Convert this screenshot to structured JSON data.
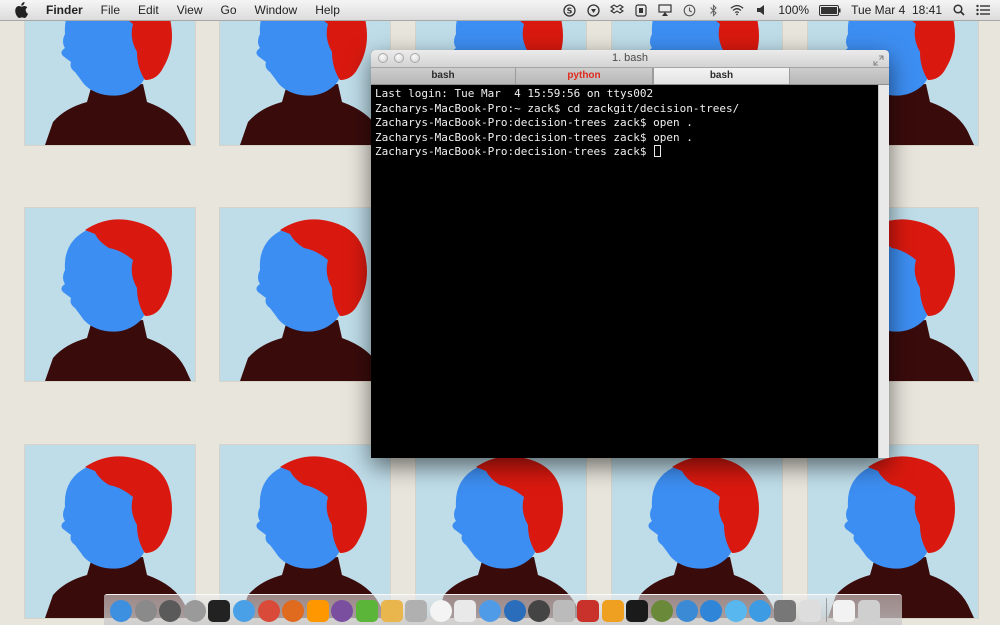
{
  "menubar": {
    "app_name": "Finder",
    "menus": [
      "File",
      "Edit",
      "View",
      "Go",
      "Window",
      "Help"
    ],
    "status_icons": [
      "skype-icon",
      "evernote-icon",
      "dropbox-icon",
      "growl-icon",
      "airplay-icon",
      "time-machine-icon",
      "bluetooth-icon",
      "wifi-icon",
      "volume-icon"
    ],
    "battery": "100%",
    "datetime": "Tue Mar 4  18:41",
    "right_icons": [
      "spotlight-icon",
      "notification-center-icon"
    ]
  },
  "terminal": {
    "title": "1. bash",
    "tabs": [
      {
        "label": "bash",
        "active": false,
        "busy": false
      },
      {
        "label": "python",
        "active": false,
        "busy": true
      },
      {
        "label": "bash",
        "active": true,
        "busy": false
      }
    ],
    "lines": [
      "Last login: Tue Mar  4 15:59:56 on ttys002",
      "Zacharys-MacBook-Pro:~ zack$ cd zackgit/decision-trees/",
      "Zacharys-MacBook-Pro:decision-trees zack$ open .",
      "Zacharys-MacBook-Pro:decision-trees zack$ open .",
      "Zacharys-MacBook-Pro:decision-trees zack$ "
    ]
  },
  "dock": {
    "apps": [
      {
        "name": "finder-icon",
        "color": "#3d8fe0"
      },
      {
        "name": "launchpad-icon",
        "color": "#8a8a8a"
      },
      {
        "name": "activity-monitor-icon",
        "color": "#5a5a5a"
      },
      {
        "name": "calculator-icon",
        "color": "#9a9a9a"
      },
      {
        "name": "terminal-icon",
        "color": "#222222"
      },
      {
        "name": "safari-icon",
        "color": "#4aa0e6"
      },
      {
        "name": "chrome-icon",
        "color": "#d94a38"
      },
      {
        "name": "firefox-icon",
        "color": "#e06a1e"
      },
      {
        "name": "sublime-text-icon",
        "color": "#ff9800"
      },
      {
        "name": "emacs-icon",
        "color": "#7b4fa0"
      },
      {
        "name": "evernote-icon",
        "color": "#5bb538"
      },
      {
        "name": "sketch-icon",
        "color": "#e8b64c"
      },
      {
        "name": "preview-icon",
        "color": "#b0b0b0"
      },
      {
        "name": "calendar-icon",
        "color": "#f4f4f4"
      },
      {
        "name": "reminders-icon",
        "color": "#e9e9e9"
      },
      {
        "name": "messages-icon",
        "color": "#4f9be8"
      },
      {
        "name": "r-icon",
        "color": "#2a6ebb"
      },
      {
        "name": "photo-booth-icon",
        "color": "#444444"
      },
      {
        "name": "photo-icon",
        "color": "#bbbbbb"
      },
      {
        "name": "flashcards-icon",
        "color": "#c8322a"
      },
      {
        "name": "notes-icon",
        "color": "#f0a020"
      },
      {
        "name": "pandora-icon",
        "color": "#1a1a1a"
      },
      {
        "name": "game-center-icon",
        "color": "#6a8a3a"
      },
      {
        "name": "itunes-icon",
        "color": "#3a8ad6"
      },
      {
        "name": "app-store-icon",
        "color": "#2f86d9"
      },
      {
        "name": "twitter-icon",
        "color": "#58b7ee"
      },
      {
        "name": "ichat-icon",
        "color": "#3c9be2"
      },
      {
        "name": "system-preferences-icon",
        "color": "#777777"
      },
      {
        "name": "slack-icon",
        "color": "#dddddd"
      }
    ],
    "right": [
      {
        "name": "documents-stack-icon",
        "color": "#f2f2f2"
      },
      {
        "name": "trash-icon",
        "color": "#cfcfcf"
      }
    ]
  },
  "colors": {
    "wallpaper_bg": "#bfdde9",
    "face_blue": "#3d8ef2",
    "hair_red": "#d9190f",
    "shirt_dark": "#3a0b0b",
    "terminal_bg": "#000000",
    "terminal_text": "#f0f0f0",
    "busy_tab": "#e02a1d"
  }
}
